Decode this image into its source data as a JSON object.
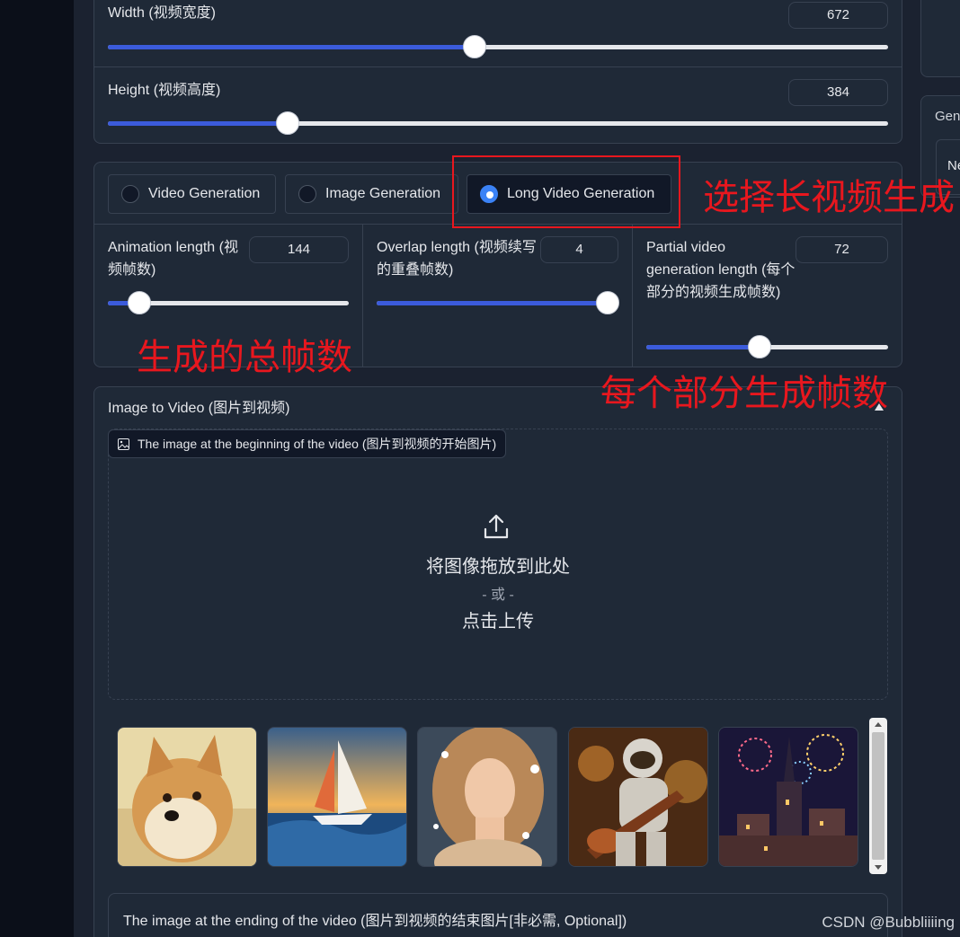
{
  "resolution": {
    "width": {
      "label": "Width (视频宽度)",
      "value": "672",
      "fraction": 0.47
    },
    "height": {
      "label": "Height (视频高度)",
      "value": "384",
      "fraction": 0.23
    }
  },
  "mode_radio": {
    "options": [
      "Video Generation",
      "Image Generation",
      "Long Video Generation"
    ],
    "selected": "Long Video Generation"
  },
  "long_video": {
    "animation_length": {
      "label": "Animation length (视频帧数)",
      "value": "144",
      "fraction": 0.13
    },
    "overlap_length": {
      "label": "Overlap length (视频续写的重叠帧数)",
      "value": "4",
      "fraction": 1.0
    },
    "partial_length": {
      "label": "Partial video generation length (每个部分的视频生成帧数)",
      "value": "72",
      "fraction": 0.47
    }
  },
  "annotations": {
    "select_long": "选择长视频生成",
    "total_frames": "生成的总帧数",
    "part_frames": "每个部分生成帧数"
  },
  "image_to_video": {
    "title": "Image to Video (图片到视频)",
    "start_tag": "The image at the beginning of the video (图片到视频的开始图片)",
    "drop_text": "将图像拖放到此处",
    "or_text": "- 或 -",
    "click_text": "点击上传",
    "examples": [
      "shiba-dog",
      "sailboat",
      "woman-portrait",
      "astronaut-guitar",
      "fireworks-castle"
    ],
    "ending_label": "The image at the ending of the video (图片到视频的结束图片[非必需, Optional])"
  },
  "right_panel": {
    "tab_label": "Gen",
    "field_label": "Ne"
  },
  "watermark": "CSDN @Bubbliiiing"
}
